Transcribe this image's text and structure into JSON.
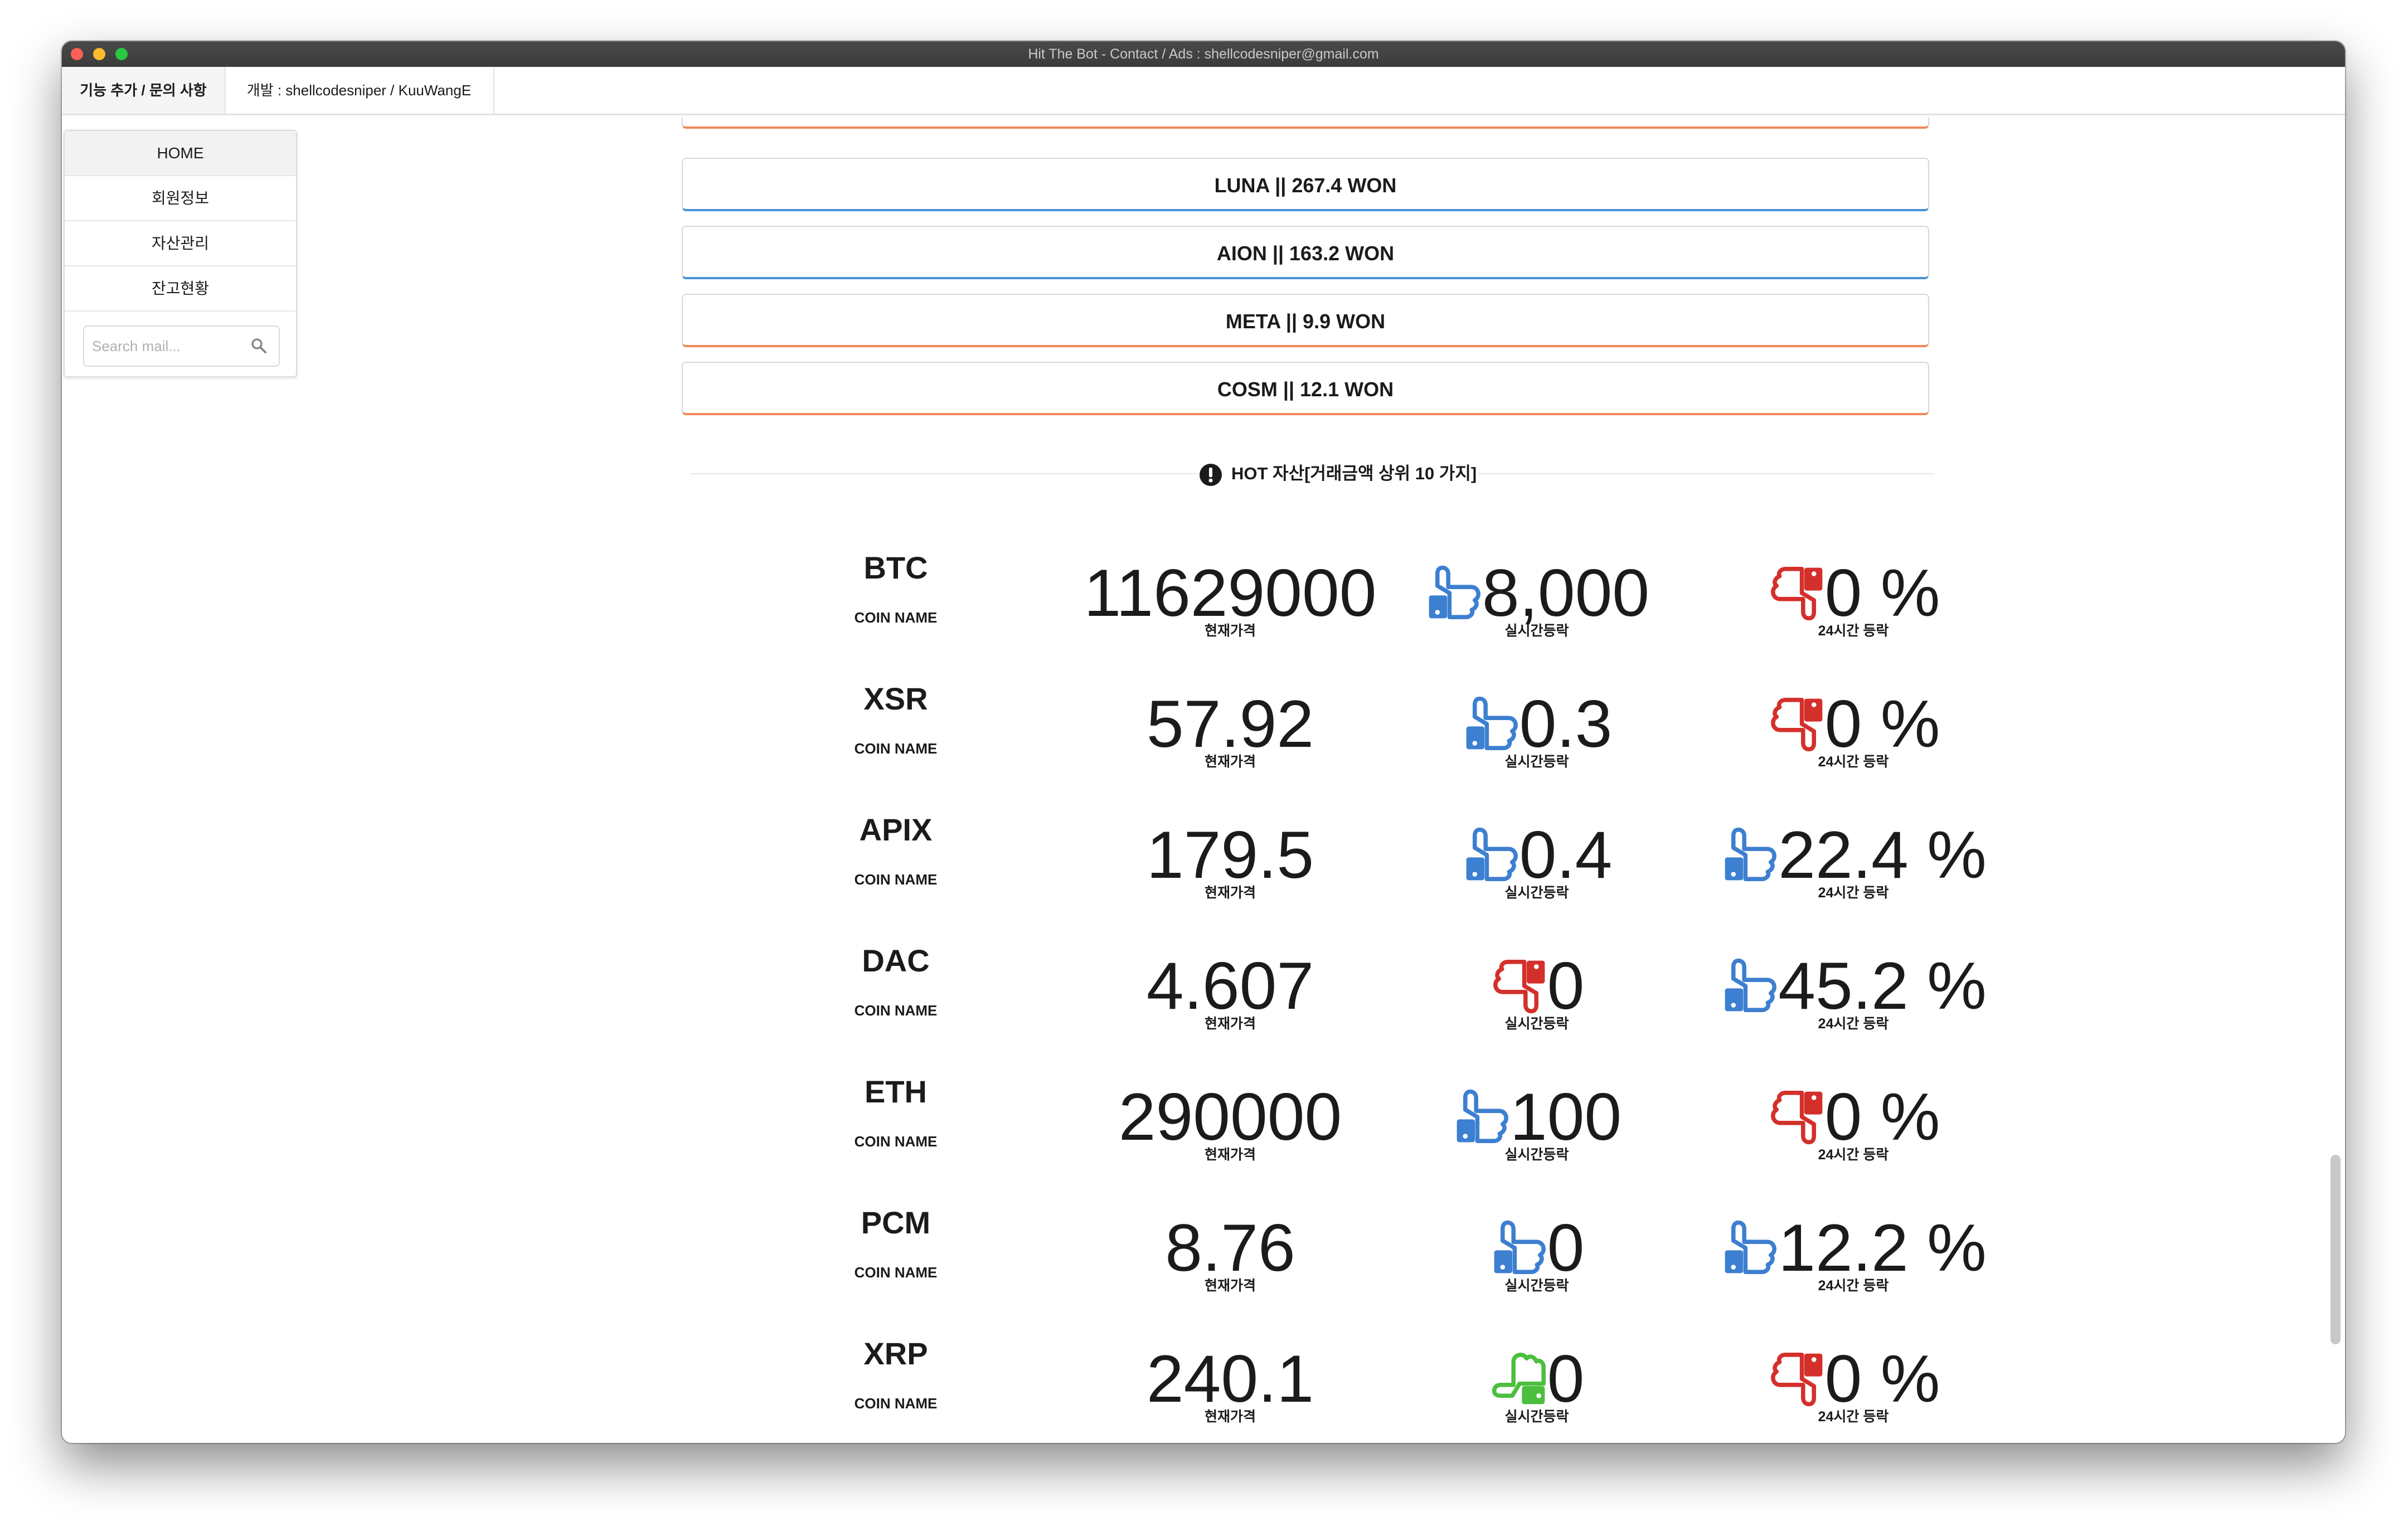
{
  "window": {
    "title": "Hit The Bot - Contact / Ads : shellcodesniper@gmail.com"
  },
  "tabs": [
    {
      "label": "기능 추가 / 문의 사항"
    },
    {
      "label": "개발 : shellcodesniper / KuuWangE"
    }
  ],
  "sidebar": {
    "items": [
      {
        "label": "HOME"
      },
      {
        "label": "회원정보"
      },
      {
        "label": "자산관리"
      },
      {
        "label": "잔고현황"
      }
    ],
    "search_placeholder": "Search mail..."
  },
  "coin_list": [
    {
      "label": "LUNA || 267.4 WON",
      "accent": "#4a90d9"
    },
    {
      "label": "AION || 163.2 WON",
      "accent": "#4a90d9"
    },
    {
      "label": "META || 9.9 WON",
      "accent": "#f0875a"
    },
    {
      "label": "COSM || 12.1 WON",
      "accent": "#f0875a"
    }
  ],
  "hot_section": {
    "title": "HOT 자산[거래금액 상위 10 가지]",
    "coin_name_label": "COIN NAME",
    "price_label": "현재가격",
    "change_label": "실시간등락",
    "change24_label": "24시간 등락",
    "rows": [
      {
        "coin": "BTC",
        "price": "11629000",
        "change": "8,000",
        "change_icon": "thumb-up-blue",
        "change24": "0 %",
        "change24_icon": "thumb-down-red"
      },
      {
        "coin": "XSR",
        "price": "57.92",
        "change": "0.3",
        "change_icon": "thumb-up-blue",
        "change24": "0 %",
        "change24_icon": "thumb-down-red"
      },
      {
        "coin": "APIX",
        "price": "179.5",
        "change": "0.4",
        "change_icon": "thumb-up-blue",
        "change24": "22.4 %",
        "change24_icon": "thumb-up-blue"
      },
      {
        "coin": "DAC",
        "price": "4.607",
        "change": "0",
        "change_icon": "thumb-down-red",
        "change24": "45.2 %",
        "change24_icon": "thumb-up-blue"
      },
      {
        "coin": "ETH",
        "price": "290000",
        "change": "100",
        "change_icon": "thumb-up-blue",
        "change24": "0 %",
        "change24_icon": "thumb-down-red"
      },
      {
        "coin": "PCM",
        "price": "8.76",
        "change": "0",
        "change_icon": "thumb-up-blue",
        "change24": "12.2 %",
        "change24_icon": "thumb-up-blue"
      },
      {
        "coin": "XRP",
        "price": "240.1",
        "change": "0",
        "change_icon": "thumb-side-green",
        "change24": "0 %",
        "change24_icon": "thumb-down-red"
      }
    ]
  },
  "colors": {
    "up": "#3d7fd0",
    "down": "#d4302b",
    "neutral": "#4cbf3e",
    "orange_accent": "#f0875a",
    "blue_accent": "#4a90d9"
  }
}
